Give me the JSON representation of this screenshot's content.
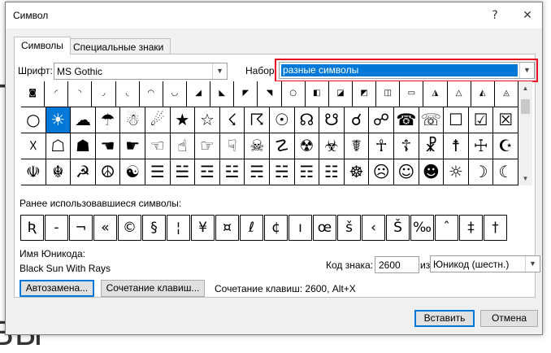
{
  "dialog": {
    "title": "Символ",
    "help_label": "?",
    "close_label": "✕"
  },
  "tabs": [
    {
      "label": "Символы",
      "active": true
    },
    {
      "label": "Специальные знаки",
      "active": false
    }
  ],
  "font_field": {
    "label": "Шрифт:",
    "value": "MS Gothic"
  },
  "subset_field": {
    "label": "Набор:",
    "value": "разные символы"
  },
  "symbol_grid": [
    [
      "◙",
      "◜",
      "◝",
      "◞",
      "◟",
      "◠",
      "◡",
      "◢",
      "◣",
      "◤",
      "◥",
      "○",
      "◧",
      "◪",
      "◩",
      "◫",
      "▭",
      "◮",
      "△",
      "◭",
      "◬"
    ],
    [
      "○",
      "☀",
      "☁",
      "☂",
      "☃",
      "☄",
      "★",
      "☆",
      "☇",
      "☈",
      "☉",
      "☊",
      "☋",
      "☌",
      "☍",
      "☎",
      "☏",
      "☐",
      "☑",
      "☒"
    ],
    [
      "☓",
      "☖",
      "☗",
      "☚",
      "☛",
      "☜",
      "☝",
      "☞",
      "☟",
      "☠",
      "☡",
      "☢",
      "☣",
      "☤",
      "☥",
      "☦",
      "☧",
      "☨",
      "☩",
      "☪"
    ],
    [
      "☫",
      "☬",
      "☭",
      "☮",
      "☯",
      "☰",
      "☱",
      "☲",
      "☳",
      "☴",
      "☵",
      "☶",
      "☷",
      "☸",
      "☹",
      "☺",
      "☻",
      "☼",
      "☽",
      "☾"
    ]
  ],
  "selected_symbol": "☀",
  "recent": {
    "label": "Ранее использовавшиеся символы:",
    "symbols": [
      "Ʀ",
      "-",
      "¬",
      "«",
      "©",
      "§",
      "¦",
      "¥",
      "¤",
      "ℓ",
      "¢",
      "ı",
      "œ",
      "š",
      "‹",
      "Š",
      "‰",
      "ˆ",
      "‡",
      "†"
    ]
  },
  "unicode_name": {
    "label": "Имя Юникода:",
    "value": "Black Sun With Rays"
  },
  "char_code": {
    "label": "Код знака:",
    "value": "2600"
  },
  "from_field": {
    "label": "из:",
    "value": "Юникод (шестн.)"
  },
  "buttons": {
    "autocorrect": "Автозамена...",
    "shortcut_key": "Сочетание клавиш...",
    "shortcut_info": "Сочетание клавиш: 2600, Alt+X",
    "insert": "Вставить",
    "cancel": "Отмена"
  },
  "background_doc": {
    "text_top": "П",
    "text_bottom": "ВЫ"
  },
  "colors": {
    "highlight": "#0078d7",
    "red_box": "#e81123",
    "dialog_bg": "#f0f0f0"
  }
}
